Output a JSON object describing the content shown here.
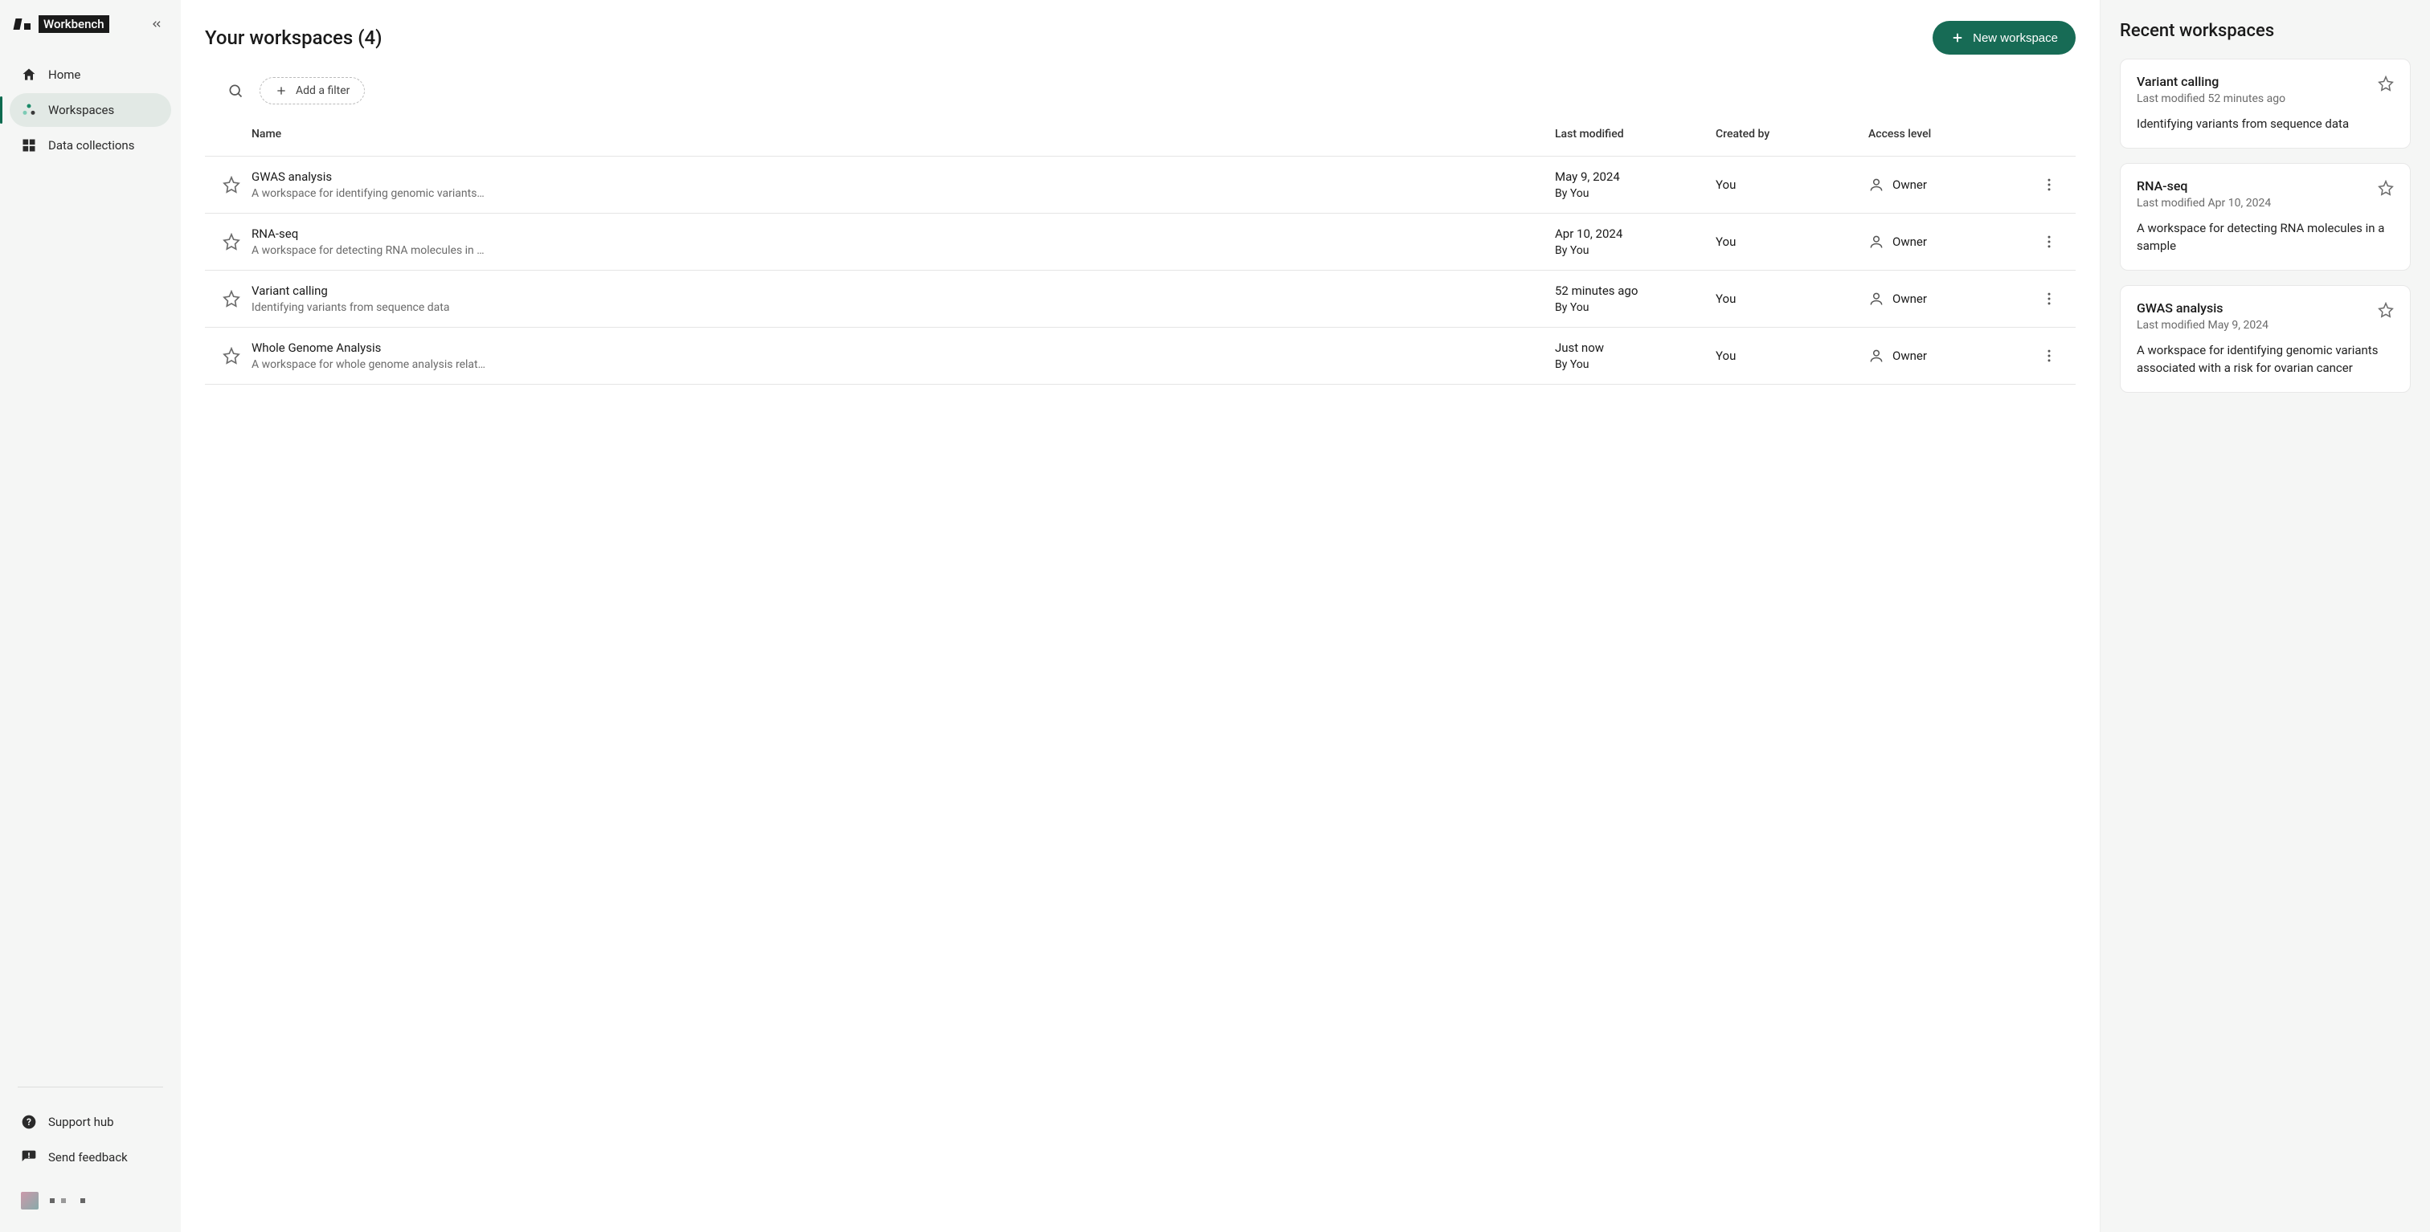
{
  "brand": {
    "name": "Workbench"
  },
  "sidebar": {
    "items": [
      {
        "label": "Home"
      },
      {
        "label": "Workspaces"
      },
      {
        "label": "Data collections"
      }
    ],
    "support": {
      "label": "Support hub"
    },
    "feedback": {
      "label": "Send feedback"
    }
  },
  "header": {
    "title": "Your workspaces (4)",
    "new_button": "New workspace"
  },
  "filters": {
    "add_filter": "Add a filter"
  },
  "table": {
    "columns": {
      "name": "Name",
      "last_modified": "Last modified",
      "created_by": "Created by",
      "access": "Access level"
    },
    "rows": [
      {
        "name": "GWAS analysis",
        "description": "A workspace for identifying genomic variants…",
        "date": "May 9, 2024",
        "by": "By You",
        "created_by": "You",
        "access": "Owner"
      },
      {
        "name": "RNA-seq",
        "description": "A workspace for detecting RNA molecules in …",
        "date": "Apr 10, 2024",
        "by": "By You",
        "created_by": "You",
        "access": "Owner"
      },
      {
        "name": "Variant calling",
        "description": "Identifying variants from sequence data",
        "date": "52 minutes ago",
        "by": "By You",
        "created_by": "You",
        "access": "Owner"
      },
      {
        "name": "Whole Genome Analysis",
        "description": "A workspace for whole genome analysis relat…",
        "date": "Just now",
        "by": "By You",
        "created_by": "You",
        "access": "Owner"
      }
    ]
  },
  "recent": {
    "title": "Recent workspaces",
    "cards": [
      {
        "title": "Variant calling",
        "subtitle": "Last modified 52 minutes ago",
        "description": "Identifying variants from sequence data"
      },
      {
        "title": "RNA-seq",
        "subtitle": "Last modified Apr 10, 2024",
        "description": "A workspace for detecting RNA molecules in a sample"
      },
      {
        "title": "GWAS analysis",
        "subtitle": "Last modified May 9, 2024",
        "description": "A workspace for identifying genomic variants associated with a risk for ovarian cancer"
      }
    ]
  }
}
